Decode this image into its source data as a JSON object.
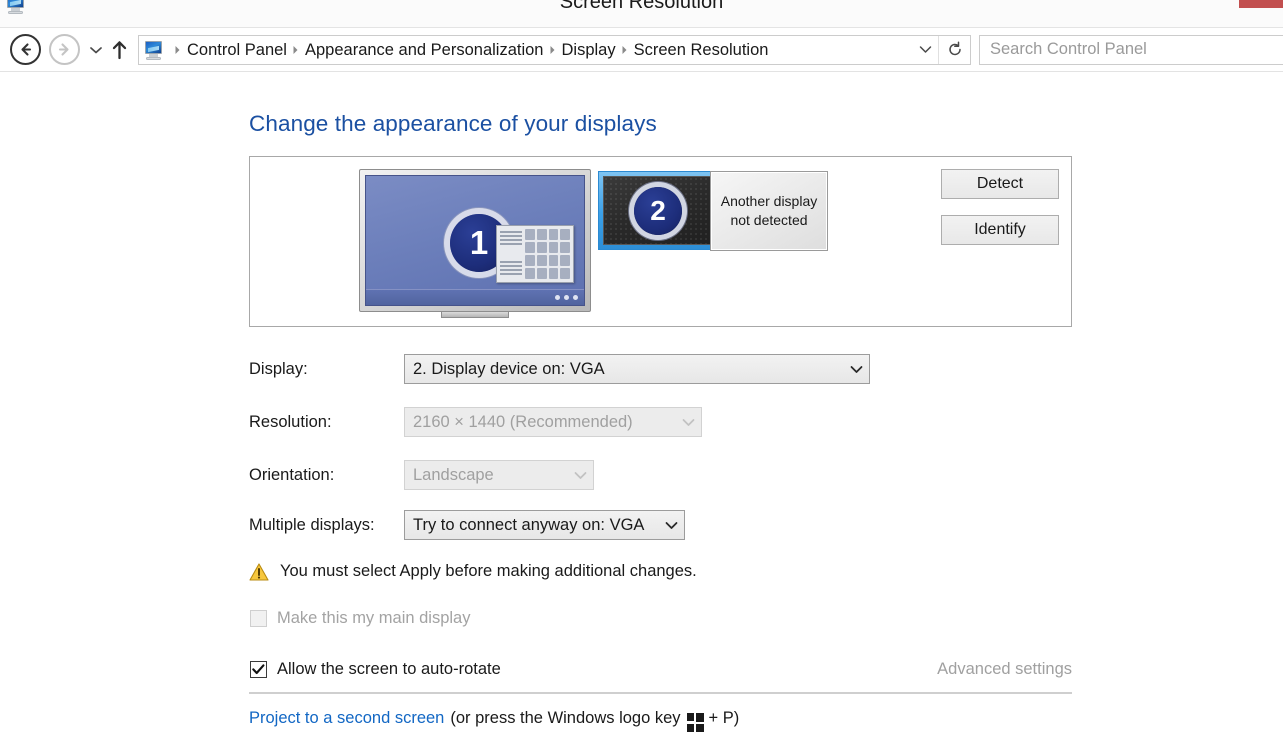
{
  "window": {
    "title": "Screen Resolution",
    "icon": "monitor-icon",
    "controls": {
      "minimize": "minimize-button",
      "maximize": "maximize-button",
      "close": "close-button",
      "close_color": "#c24f4f"
    }
  },
  "navbar": {
    "back": "back-button",
    "forward": "forward-button",
    "recent": "recent-locations-button",
    "up": "up-button",
    "breadcrumb": {
      "icon": "display-icon",
      "items": [
        "Control Panel",
        "Appearance and Personalization",
        "Display",
        "Screen Resolution"
      ]
    },
    "address_dropdown": "chevron-down-icon",
    "refresh": "refresh-icon",
    "search": {
      "placeholder": "Search Control Panel",
      "value": ""
    }
  },
  "main": {
    "heading": "Change the appearance of your displays",
    "preview": {
      "display1": {
        "number": "1",
        "selected": false
      },
      "display2": {
        "number": "2",
        "selected": true
      },
      "not_detected": {
        "line1": "Another display",
        "line2": "not detected"
      },
      "buttons": {
        "detect": "Detect",
        "identify": "Identify"
      }
    },
    "fields": {
      "display": {
        "label": "Display:",
        "value": "2. Display device on: VGA",
        "disabled": false
      },
      "resolution": {
        "label": "Resolution:",
        "value": "2160 × 1440 (Recommended)",
        "disabled": true
      },
      "orientation": {
        "label": "Orientation:",
        "value": "Landscape",
        "disabled": true
      },
      "multiple_displays": {
        "label": "Multiple displays:",
        "value": "Try to connect anyway on: VGA",
        "disabled": false
      }
    },
    "warning": {
      "icon": "warning-triangle-icon",
      "text": "You must select Apply before making additional changes."
    },
    "main_display_checkbox": {
      "label": "Make this my main display",
      "checked": false,
      "disabled": true
    },
    "autorotate_checkbox": {
      "label": "Allow the screen to auto-rotate",
      "checked": true,
      "disabled": false
    },
    "advanced_settings": {
      "label": "Advanced settings",
      "disabled": true
    },
    "project": {
      "link": "Project to a second screen",
      "before_key": "(or press the Windows logo key",
      "key_icon": "windows-logo-icon",
      "after_key": "+ P)"
    }
  }
}
